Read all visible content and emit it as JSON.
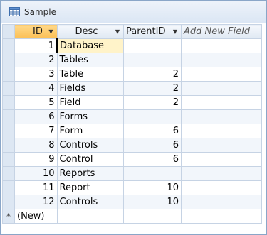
{
  "window": {
    "title": "Sample",
    "icon": "table-icon"
  },
  "columns": {
    "id": "ID",
    "desc": "Desc",
    "parent": "ParentID",
    "add": "Add New Field"
  },
  "rows": [
    {
      "id": "1",
      "desc": "Database",
      "parent": ""
    },
    {
      "id": "2",
      "desc": "Tables",
      "parent": ""
    },
    {
      "id": "3",
      "desc": "Table",
      "parent": "2"
    },
    {
      "id": "4",
      "desc": "Fields",
      "parent": "2"
    },
    {
      "id": "5",
      "desc": "Field",
      "parent": "2"
    },
    {
      "id": "6",
      "desc": "Forms",
      "parent": ""
    },
    {
      "id": "7",
      "desc": "Form",
      "parent": "6"
    },
    {
      "id": "8",
      "desc": "Controls",
      "parent": "6"
    },
    {
      "id": "9",
      "desc": "Control",
      "parent": "6"
    },
    {
      "id": "10",
      "desc": "Reports",
      "parent": ""
    },
    {
      "id": "11",
      "desc": "Report",
      "parent": "10"
    },
    {
      "id": "12",
      "desc": "Controls",
      "parent": "10"
    }
  ],
  "new_row": {
    "marker": "*",
    "label": "(New)"
  }
}
